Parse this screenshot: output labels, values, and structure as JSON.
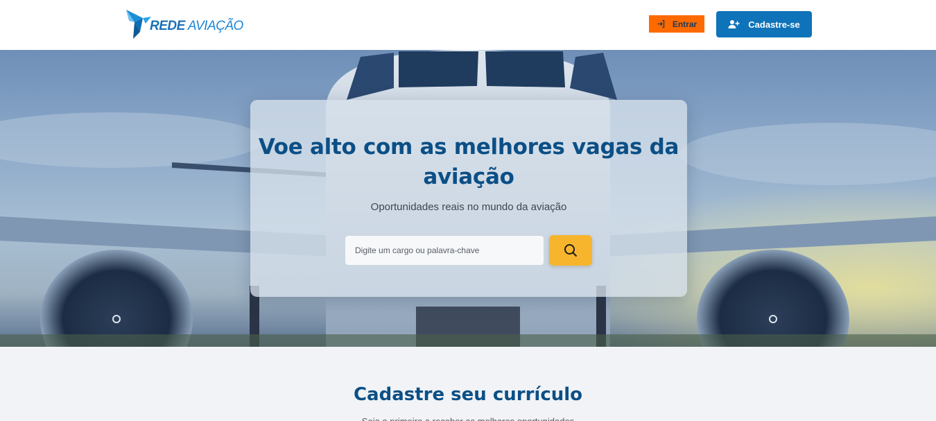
{
  "header": {
    "logo": {
      "bold": "REDE",
      "light": "AVIAÇÃO"
    },
    "login_label": "Entrar",
    "signup_label": "Cadastre-se",
    "login_color": "#ff6a00",
    "signup_color": "#0e73b9"
  },
  "hero": {
    "title": "Voe alto com as melhores vagas da aviação",
    "subtitle": "Oportunidades reais no mundo da aviação",
    "search": {
      "placeholder": "Digite um cargo ou palavra-chave",
      "value": ""
    },
    "search_button_icon": "search-icon",
    "accent_color": "#f7b52e"
  },
  "section": {
    "title": "Cadastre seu currículo",
    "subtitle_cut": "Seja o primeiro a receber as melhores oportunidades"
  }
}
